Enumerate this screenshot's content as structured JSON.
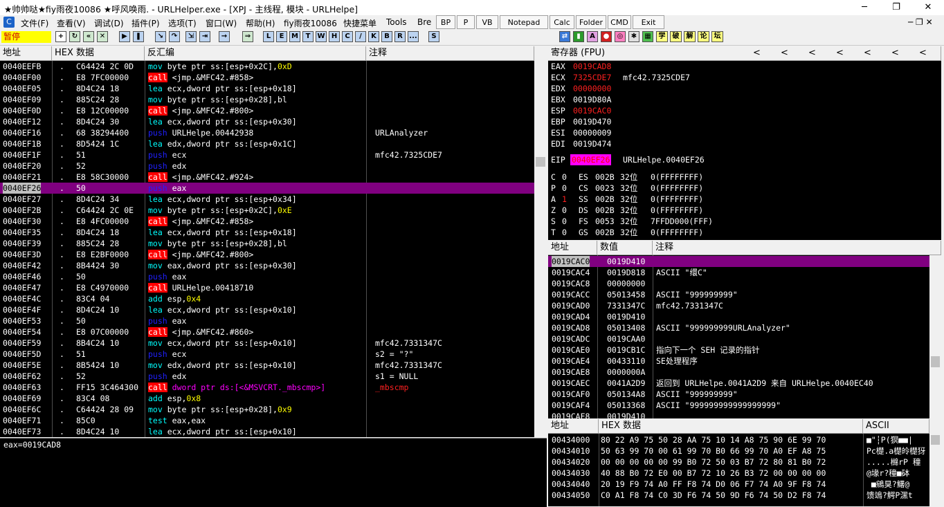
{
  "window": {
    "title": "★帅帅哒★fiy雨夜10086 ★呼风唤雨. - URLHelper.exe - [XPJ - 主线程, 模块 - URLHelpe]",
    "minimize": "─",
    "maximize": "❐",
    "close": "✕"
  },
  "menubar": {
    "items": [
      "文件(F)",
      "查看(V)",
      "调试(D)",
      "插件(P)",
      "选项(T)",
      "窗口(W)",
      "帮助(H)",
      "fiy雨夜10086",
      "快捷菜单",
      "Tools",
      "Bre"
    ],
    "buttons": [
      "BP",
      "P",
      "VB",
      "Notepad",
      "Calc",
      "Folder",
      "CMD",
      "Exit"
    ]
  },
  "toolbar": {
    "status": "暂停",
    "letter_buttons": [
      "L",
      "E",
      "M",
      "T",
      "W",
      "H",
      "C",
      "/",
      "K",
      "B",
      "R",
      "...",
      "S"
    ],
    "plugin_buttons": [
      "学",
      "破",
      "解",
      "论",
      "坛"
    ]
  },
  "disasm": {
    "headers": {
      "addr": "地址",
      "hex": "HEX 数据",
      "code": "反汇编",
      "comment": "注释"
    },
    "rows": [
      {
        "a": "0040EEFB",
        "hex": "C64424 2C 0D",
        "tokens": [
          [
            "mov",
            "cy"
          ],
          [
            " byte ptr ss:[esp+0x2C],",
            "wh"
          ],
          [
            "0xD",
            "yl"
          ]
        ],
        "cm": ""
      },
      {
        "a": "0040EF00",
        "hex": "E8 7FC00000",
        "tokens": [
          [
            "call",
            "callb"
          ],
          [
            " <jmp.&MFC42.#858>",
            "wh"
          ]
        ],
        "cm": ""
      },
      {
        "a": "0040EF05",
        "hex": "8D4C24 18",
        "tokens": [
          [
            "lea",
            "cy"
          ],
          [
            " ecx,dword ptr ss:[esp+0x18]",
            "wh"
          ]
        ],
        "cm": ""
      },
      {
        "a": "0040EF09",
        "hex": "885C24 28",
        "tokens": [
          [
            "mov",
            "cy"
          ],
          [
            " byte ptr ss:[esp+0x28],bl",
            "wh"
          ]
        ],
        "cm": ""
      },
      {
        "a": "0040EF0D",
        "hex": "E8 12C00000",
        "tokens": [
          [
            "call",
            "callb"
          ],
          [
            " <jmp.&MFC42.#800>",
            "wh"
          ]
        ],
        "cm": ""
      },
      {
        "a": "0040EF12",
        "hex": "8D4C24 30",
        "tokens": [
          [
            "lea",
            "cy"
          ],
          [
            " ecx,dword ptr ss:[esp+0x30]",
            "wh"
          ]
        ],
        "cm": ""
      },
      {
        "a": "0040EF16",
        "hex": "68 38294400",
        "tokens": [
          [
            "push",
            "bl"
          ],
          [
            " URLHelpe.00442938",
            "wh"
          ]
        ],
        "cm": "URLAnalyzer"
      },
      {
        "a": "0040EF1B",
        "hex": "8D5424 1C",
        "tokens": [
          [
            "lea",
            "cy"
          ],
          [
            " edx,dword ptr ss:[esp+0x1C]",
            "wh"
          ]
        ],
        "cm": ""
      },
      {
        "a": "0040EF1F",
        "hex": "51",
        "tokens": [
          [
            "push",
            "bl"
          ],
          [
            " ecx",
            "wh"
          ]
        ],
        "cm": "mfc42.7325CDE7"
      },
      {
        "a": "0040EF20",
        "hex": "52",
        "tokens": [
          [
            "push",
            "bl"
          ],
          [
            " edx",
            "wh"
          ]
        ],
        "cm": ""
      },
      {
        "a": "0040EF21",
        "hex": "E8 58C30000",
        "tokens": [
          [
            "call",
            "callb"
          ],
          [
            " <jmp.&MFC42.#924>",
            "wh"
          ]
        ],
        "cm": ""
      },
      {
        "a": "0040EF26",
        "hex": "50",
        "tokens": [
          [
            "push",
            "bl"
          ],
          [
            " eax",
            "wh"
          ]
        ],
        "cm": "",
        "sel": true
      },
      {
        "a": "0040EF27",
        "hex": "8D4C24 34",
        "tokens": [
          [
            "lea",
            "cy"
          ],
          [
            " ecx,dword ptr ss:[esp+0x34]",
            "wh"
          ]
        ],
        "cm": ""
      },
      {
        "a": "0040EF2B",
        "hex": "C64424 2C 0E",
        "tokens": [
          [
            "mov",
            "cy"
          ],
          [
            " byte ptr ss:[esp+0x2C],",
            "wh"
          ],
          [
            "0xE",
            "yl"
          ]
        ],
        "cm": ""
      },
      {
        "a": "0040EF30",
        "hex": "E8 4FC00000",
        "tokens": [
          [
            "call",
            "callb"
          ],
          [
            " <jmp.&MFC42.#858>",
            "wh"
          ]
        ],
        "cm": ""
      },
      {
        "a": "0040EF35",
        "hex": "8D4C24 18",
        "tokens": [
          [
            "lea",
            "cy"
          ],
          [
            " ecx,dword ptr ss:[esp+0x18]",
            "wh"
          ]
        ],
        "cm": ""
      },
      {
        "a": "0040EF39",
        "hex": "885C24 28",
        "tokens": [
          [
            "mov",
            "cy"
          ],
          [
            " byte ptr ss:[esp+0x28],bl",
            "wh"
          ]
        ],
        "cm": ""
      },
      {
        "a": "0040EF3D",
        "hex": "E8 E2BF0000",
        "tokens": [
          [
            "call",
            "callb"
          ],
          [
            " <jmp.&MFC42.#800>",
            "wh"
          ]
        ],
        "cm": ""
      },
      {
        "a": "0040EF42",
        "hex": "8B4424 30",
        "tokens": [
          [
            "mov",
            "cy"
          ],
          [
            " eax,dword ptr ss:[esp+0x30]",
            "wh"
          ]
        ],
        "cm": ""
      },
      {
        "a": "0040EF46",
        "hex": "50",
        "tokens": [
          [
            "push",
            "bl"
          ],
          [
            " eax",
            "wh"
          ]
        ],
        "cm": ""
      },
      {
        "a": "0040EF47",
        "hex": "E8 C4970000",
        "tokens": [
          [
            "call",
            "callb"
          ],
          [
            " URLHelpe.00418710",
            "wh"
          ]
        ],
        "cm": ""
      },
      {
        "a": "0040EF4C",
        "hex": "83C4 04",
        "tokens": [
          [
            "add",
            "cy"
          ],
          [
            " esp,",
            "wh"
          ],
          [
            "0x4",
            "yl"
          ]
        ],
        "cm": ""
      },
      {
        "a": "0040EF4F",
        "hex": "8D4C24 10",
        "tokens": [
          [
            "lea",
            "cy"
          ],
          [
            " ecx,dword ptr ss:[esp+0x10]",
            "wh"
          ]
        ],
        "cm": ""
      },
      {
        "a": "0040EF53",
        "hex": "50",
        "tokens": [
          [
            "push",
            "bl"
          ],
          [
            " eax",
            "wh"
          ]
        ],
        "cm": ""
      },
      {
        "a": "0040EF54",
        "hex": "E8 07C00000",
        "tokens": [
          [
            "call",
            "callb"
          ],
          [
            " <jmp.&MFC42.#860>",
            "wh"
          ]
        ],
        "cm": ""
      },
      {
        "a": "0040EF59",
        "hex": "8B4C24 10",
        "tokens": [
          [
            "mov",
            "cy"
          ],
          [
            " ecx,dword ptr ss:[esp+0x10]",
            "wh"
          ]
        ],
        "cm": "mfc42.7331347C"
      },
      {
        "a": "0040EF5D",
        "hex": "51",
        "tokens": [
          [
            "push",
            "bl"
          ],
          [
            " ecx",
            "wh"
          ]
        ],
        "cm": "s2 = \"?\""
      },
      {
        "a": "0040EF5E",
        "hex": "8B5424 10",
        "tokens": [
          [
            "mov",
            "cy"
          ],
          [
            " edx,dword ptr ss:[esp+0x10]",
            "wh"
          ]
        ],
        "cm": "mfc42.7331347C"
      },
      {
        "a": "0040EF62",
        "hex": "52",
        "tokens": [
          [
            "push",
            "bl"
          ],
          [
            " edx",
            "wh"
          ]
        ],
        "cm": "s1 = NULL"
      },
      {
        "a": "0040EF63",
        "hex": "FF15 3C464300",
        "tokens": [
          [
            "call",
            "callb"
          ],
          [
            " dword ptr ds:[<&MSVCRT._mbscmp>]",
            "mg"
          ]
        ],
        "cm": "_mbscmp",
        "cmc": "rd"
      },
      {
        "a": "0040EF69",
        "hex": "83C4 08",
        "tokens": [
          [
            "add",
            "cy"
          ],
          [
            " esp,",
            "wh"
          ],
          [
            "0x8",
            "yl"
          ]
        ],
        "cm": ""
      },
      {
        "a": "0040EF6C",
        "hex": "C64424 28 09",
        "tokens": [
          [
            "mov",
            "cy"
          ],
          [
            " byte ptr ss:[esp+0x28],",
            "wh"
          ],
          [
            "0x9",
            "yl"
          ]
        ],
        "cm": ""
      },
      {
        "a": "0040EF71",
        "hex": "85C0",
        "tokens": [
          [
            "test",
            "cy"
          ],
          [
            " eax,eax",
            "wh"
          ]
        ],
        "cm": ""
      },
      {
        "a": "0040EF73",
        "hex": "8D4C24 10",
        "tokens": [
          [
            "lea",
            "cy"
          ],
          [
            " ecx,dword ptr ss:[esp+0x10]",
            "wh"
          ]
        ],
        "cm": ""
      }
    ]
  },
  "info_line": "eax=0019CAD8",
  "registers": {
    "header": "寄存器 (FPU)",
    "arrows": [
      "<",
      "<",
      "<",
      "<",
      "<",
      "<",
      "<"
    ],
    "gp": [
      {
        "name": "EAX",
        "val": "0019CAD8",
        "changed": true,
        "note": ""
      },
      {
        "name": "ECX",
        "val": "7325CDE7",
        "changed": true,
        "note": "mfc42.7325CDE7"
      },
      {
        "name": "EDX",
        "val": "00000000",
        "changed": true,
        "note": ""
      },
      {
        "name": "EBX",
        "val": "0019D80A",
        "changed": false,
        "note": ""
      },
      {
        "name": "ESP",
        "val": "0019CAC0",
        "changed": true,
        "note": ""
      },
      {
        "name": "EBP",
        "val": "0019D470",
        "changed": false,
        "note": ""
      },
      {
        "name": "ESI",
        "val": "00000009",
        "changed": false,
        "note": ""
      },
      {
        "name": "EDI",
        "val": "0019D474",
        "changed": false,
        "note": ""
      }
    ],
    "eip": {
      "name": "EIP",
      "val": "0040EF26",
      "note": "URLHelpe.0040EF26"
    },
    "flags": [
      {
        "f": "C",
        "v": "0",
        "seg": "ES",
        "sel": "002B",
        "bits": "32位",
        "base": "0(FFFFFFFF)"
      },
      {
        "f": "P",
        "v": "0",
        "seg": "CS",
        "sel": "0023",
        "bits": "32位",
        "base": "0(FFFFFFFF)"
      },
      {
        "f": "A",
        "v": "1",
        "seg": "SS",
        "sel": "002B",
        "bits": "32位",
        "base": "0(FFFFFFFF)"
      },
      {
        "f": "Z",
        "v": "0",
        "seg": "DS",
        "sel": "002B",
        "bits": "32位",
        "base": "0(FFFFFFFF)"
      },
      {
        "f": "S",
        "v": "0",
        "seg": "FS",
        "sel": "0053",
        "bits": "32位",
        "base": "7FFDD000(FFF)"
      },
      {
        "f": "T",
        "v": "0",
        "seg": "GS",
        "sel": "002B",
        "bits": "32位",
        "base": "0(FFFFFFFF)"
      }
    ]
  },
  "stack": {
    "headers": {
      "addr": "地址",
      "val": "数值",
      "comment": "注释"
    },
    "rows": [
      {
        "a": "0019CAC0",
        "v": "0019D410",
        "c": "",
        "sel": true
      },
      {
        "a": "0019CAC4",
        "v": "0019D818",
        "c": "ASCII \"缳C\""
      },
      {
        "a": "0019CAC8",
        "v": "00000000",
        "c": ""
      },
      {
        "a": "0019CACC",
        "v": "05013458",
        "c": "ASCII \"999999999\""
      },
      {
        "a": "0019CAD0",
        "v": "7331347C",
        "c": "mfc42.7331347C"
      },
      {
        "a": "0019CAD4",
        "v": "0019D410",
        "c": ""
      },
      {
        "a": "0019CAD8",
        "v": "05013408",
        "c": "ASCII \"999999999URLAnalyzer\""
      },
      {
        "a": "0019CADC",
        "v": "0019CAA0",
        "c": ""
      },
      {
        "a": "0019CAE0",
        "v": "0019CB1C",
        "c": "指向下一个 SEH 记录的指针"
      },
      {
        "a": "0019CAE4",
        "v": "00433110",
        "c": "SE处理程序"
      },
      {
        "a": "0019CAE8",
        "v": "0000000A",
        "c": ""
      },
      {
        "a": "0019CAEC",
        "v": "0041A2D9",
        "c": "返回到 URLHelpe.0041A2D9 来自 URLHelpe.0040EC40"
      },
      {
        "a": "0019CAF0",
        "v": "050134A8",
        "c": "ASCII \"999999999\""
      },
      {
        "a": "0019CAF4",
        "v": "05013368",
        "c": "ASCII \"999999999999999999\""
      },
      {
        "a": "0019CAF8",
        "v": "0019D410",
        "c": ""
      }
    ]
  },
  "dump": {
    "headers": {
      "addr": "地址",
      "hex": "HEX 数据",
      "ascii": "ASCII"
    },
    "rows": [
      {
        "a": "00434000",
        "h": "80 22 A9 75 50 28 AA 75 10 14 A8 75 90 6E 99 70",
        "s": "■\"┆P(猽■■∣"
      },
      {
        "a": "00434010",
        "h": "50 63 99 70 00 61 99 70 B0 66 99 70 A0 EF A8 75",
        "s": "Pc檚.a檚皊檚犽"
      },
      {
        "a": "00434020",
        "h": "00 00 00 00 00 99 B0 72 50 03 B7 72 80 81 B0 72",
        "s": ".....檰rP 穜"
      },
      {
        "a": "00434030",
        "h": "40 88 B0 72 E0 00 B7 72 10 26 B3 72 00 00 00 00",
        "s": "@堟r?穜■砵"
      },
      {
        "a": "00434040",
        "h": "20 19 F9 74 A0 FF F8 74 D0 06 F7 74 A0 9F F8 74",
        "s": " ■鵷狊?鱰@"
      },
      {
        "a": "00434050",
        "h": "C0 A1 F8 74 C0 3D F6 74 50 9D F6 74 50 D2 F8 74",
        "s": "馈鴗?鰐P潶t"
      }
    ]
  }
}
